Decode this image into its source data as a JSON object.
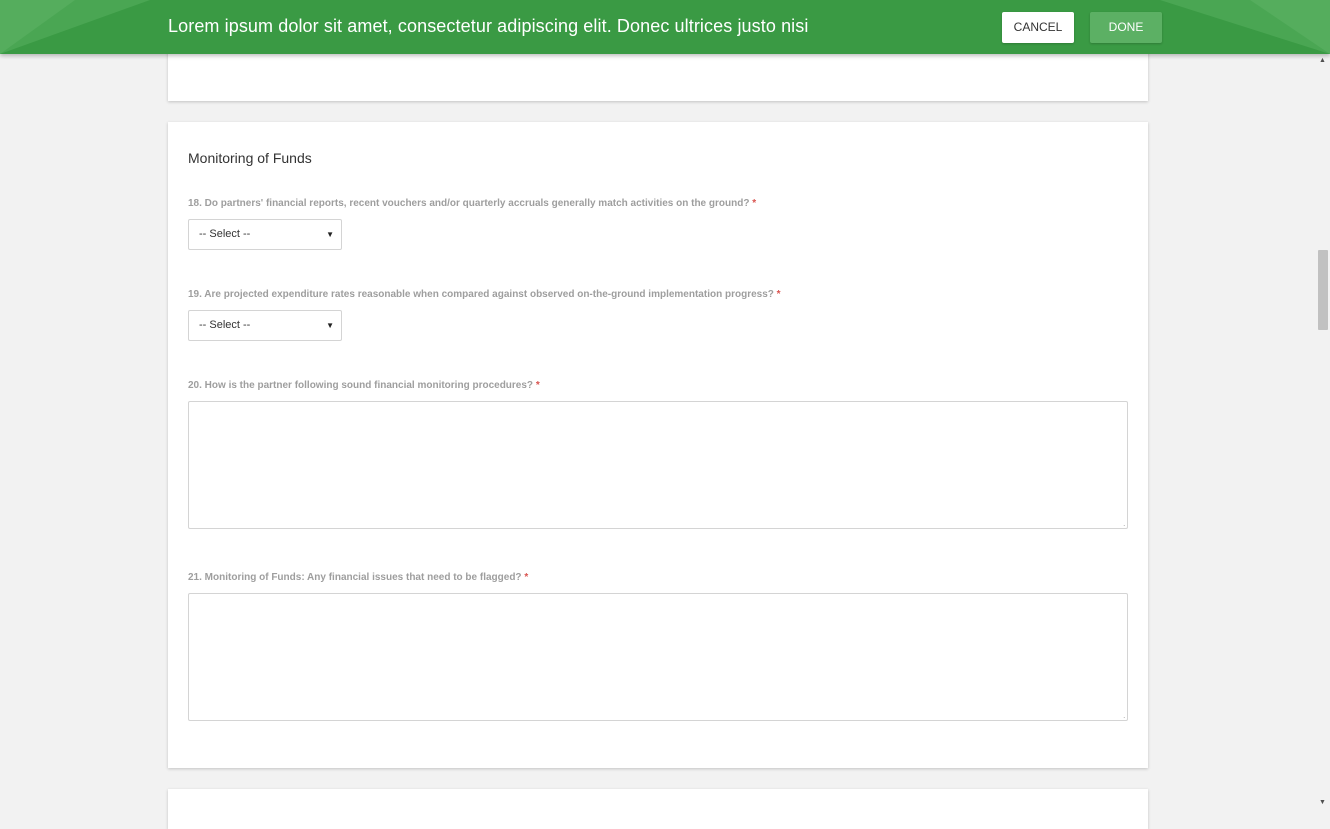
{
  "header": {
    "title": "Lorem ipsum dolor sit amet, consectetur adipiscing elit. Donec ultrices justo nisi",
    "cancel_label": "CANCEL",
    "done_label": "DONE"
  },
  "section": {
    "title": "Monitoring of Funds"
  },
  "questions": [
    {
      "label": "18. Do partners' financial reports, recent vouchers and/or quarterly accruals generally match activities on the ground?",
      "required_mark": "*",
      "type": "select",
      "value": "-- Select --"
    },
    {
      "label": "19. Are projected expenditure rates reasonable when compared against observed on-the-ground implementation progress?",
      "required_mark": "*",
      "type": "select",
      "value": "-- Select --"
    },
    {
      "label": "20. How is the partner following sound financial monitoring procedures?",
      "required_mark": "*",
      "type": "textarea",
      "value": ""
    },
    {
      "label": "21. Monitoring of Funds: Any financial issues that need to be flagged?",
      "required_mark": "*",
      "type": "textarea",
      "value": ""
    }
  ],
  "icons": {
    "select_caret": "caret-down-icon",
    "scroll_up": "scroll-up-arrow-icon",
    "scroll_down": "scroll-down-arrow-icon"
  },
  "colors": {
    "header_bg": "#3a9a44",
    "done_button": "#5cb064",
    "required": "#d9534f",
    "label": "#9e9e9e"
  }
}
